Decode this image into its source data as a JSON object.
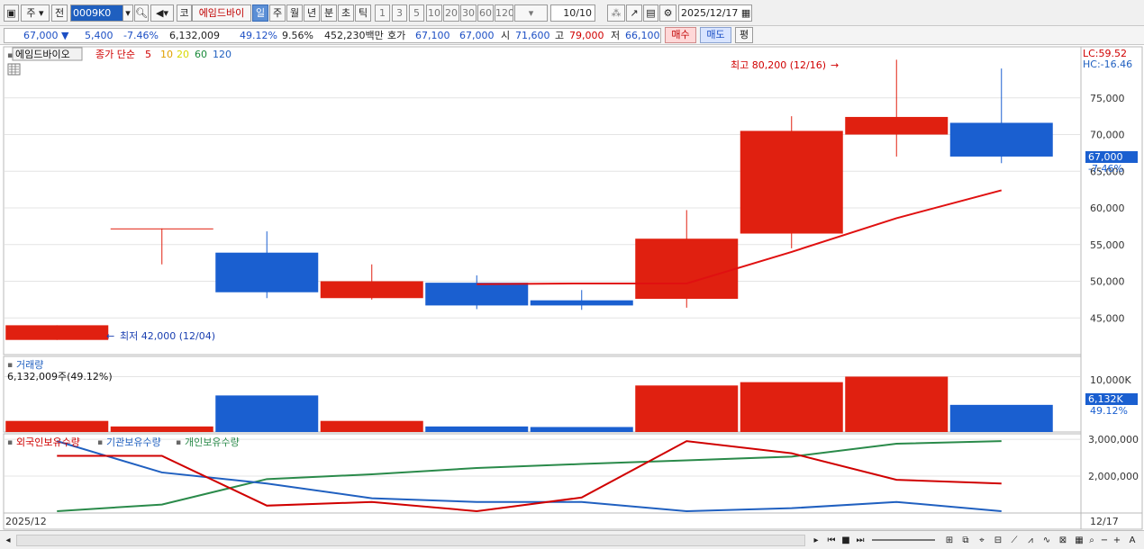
{
  "toolbar": {
    "market_sel": "주",
    "prev_btn": "전",
    "code": "0009K0",
    "kospi_btn": "코",
    "stock_name": "에임드바이",
    "periods": [
      "일",
      "주",
      "월",
      "년",
      "분",
      "초",
      "틱"
    ],
    "selected_period": "일",
    "intervals": [
      "1",
      "3",
      "5",
      "10",
      "20",
      "30",
      "60",
      "120"
    ],
    "count": "10/10",
    "date": "2025/12/17"
  },
  "infobar": {
    "price": "67,000",
    "change_arrow": "▼",
    "change": "5,400",
    "change_pct": "-7.46%",
    "volume": "6,132,009",
    "vol_ratio": "49.12%",
    "turnover": "9.56%",
    "amount": "452,230백만",
    "bid_label": "호가",
    "bid1": "67,100",
    "bid2": "67,000",
    "open_label": "시",
    "open": "71,600",
    "high_label": "고",
    "high": "79,000",
    "low_label": "저",
    "low": "66,100",
    "buy_btn": "매수",
    "sell_btn": "매도",
    "avg_btn": "평"
  },
  "price_panel": {
    "title": "에임드바이오",
    "ma_label": "종가 단순",
    "ma_periods": [
      {
        "p": "5",
        "color": "#d00000"
      },
      {
        "p": "10",
        "color": "#e0a000"
      },
      {
        "p": "20",
        "color": "#d8d800"
      },
      {
        "p": "60",
        "color": "#1a8a3a"
      },
      {
        "p": "120",
        "color": "#2060c0"
      }
    ],
    "lc": "LC:59.52",
    "hc": "HC:-16.46",
    "max_annot": "최고 80,200 (12/16)",
    "min_annot": "최저 42,000 (12/04)",
    "axis_ticks": [
      "75,000",
      "70,000",
      "65,000",
      "60,000",
      "55,000",
      "50,000",
      "45,000"
    ],
    "last_price_label": "67,000",
    "last_pct_label": "-7.46%"
  },
  "volume_panel": {
    "title": "거래량",
    "value": "6,132,009주(49.12%)",
    "axis_tick": "10,000K",
    "last_label": "6,132K",
    "last_pct": "49.12%"
  },
  "holding_panel": {
    "legend": [
      {
        "name": "외국인보유수량",
        "color": "#d00000"
      },
      {
        "name": "기관보유수량",
        "color": "#2060c0"
      },
      {
        "name": "개인보유수량",
        "color": "#2a8a4a"
      }
    ],
    "axis_ticks": [
      "3,000,000",
      "2,000,000"
    ]
  },
  "x_axis": {
    "left": "2025/12",
    "right": "12/17"
  },
  "chart_data": {
    "type": "candlestick",
    "up_color": "#e02010",
    "down_color": "#1a5fd0",
    "candles": [
      {
        "o": 42000,
        "h": 44000,
        "l": 42000,
        "c": 44000,
        "v": 2000000
      },
      {
        "o": 57200,
        "h": 57200,
        "l": 52300,
        "c": 57200,
        "v": 1000000
      },
      {
        "o": 53900,
        "h": 56800,
        "l": 47700,
        "c": 48500,
        "v": 6600000
      },
      {
        "o": 47700,
        "h": 52300,
        "l": 47500,
        "c": 50000,
        "v": 2000000
      },
      {
        "o": 49800,
        "h": 50800,
        "l": 46200,
        "c": 46700,
        "v": 1000000
      },
      {
        "o": 47400,
        "h": 48800,
        "l": 46100,
        "c": 46700,
        "v": 900000
      },
      {
        "o": 47600,
        "h": 59700,
        "l": 46400,
        "c": 55800,
        "v": 8400000
      },
      {
        "o": 56500,
        "h": 72500,
        "l": 54500,
        "c": 70500,
        "v": 9000000
      },
      {
        "o": 70000,
        "h": 80200,
        "l": 67000,
        "c": 72400,
        "v": 10000000
      },
      {
        "o": 71600,
        "h": 79000,
        "l": 66100,
        "c": 67000,
        "v": 4900000
      }
    ],
    "ma5": [
      null,
      null,
      null,
      null,
      49600,
      49700,
      49700,
      54000,
      58600,
      62400
    ],
    "price_ylim": [
      40000,
      80000
    ],
    "volume_ylim": [
      0,
      13000000
    ],
    "foreign": [
      2550000,
      2550000,
      1200000,
      1300000,
      1050000,
      1420000,
      2950000,
      2620000,
      1900000,
      1800000
    ],
    "institution": [
      2950000,
      2100000,
      1800000,
      1400000,
      1300000,
      1300000,
      1050000,
      1130000,
      1300000,
      1050000
    ],
    "individual": [
      1050000,
      1230000,
      1920000,
      2050000,
      2220000,
      2330000,
      2430000,
      2530000,
      2880000,
      2950000
    ],
    "holding_ylim": [
      1000000,
      3100000
    ]
  }
}
